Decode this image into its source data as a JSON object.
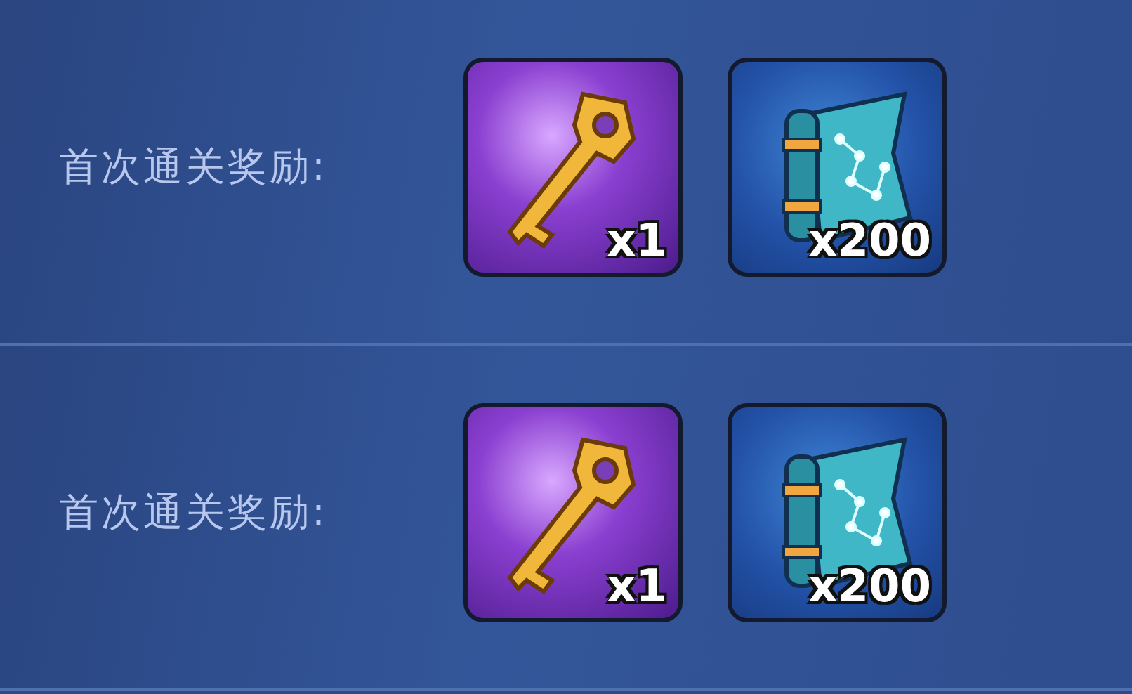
{
  "rows": [
    {
      "label": "首次通关奖励:",
      "rewards": [
        {
          "kind": "key",
          "count": "x1"
        },
        {
          "kind": "map",
          "count": "x200"
        }
      ]
    },
    {
      "label": "首次通关奖励:",
      "rewards": [
        {
          "kind": "key",
          "count": "x1"
        },
        {
          "kind": "map",
          "count": "x200"
        }
      ]
    }
  ]
}
